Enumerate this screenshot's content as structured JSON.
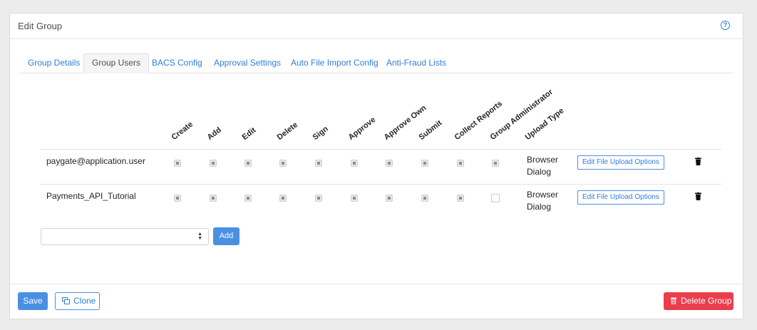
{
  "header": {
    "title": "Edit Group",
    "help_icon": "question-circle-icon"
  },
  "tabs": [
    {
      "label": "Group Details",
      "active": false
    },
    {
      "label": "Group Users",
      "active": true
    },
    {
      "label": "BACS Config",
      "active": false
    },
    {
      "label": "Approval Settings",
      "active": false
    },
    {
      "label": "Auto File Import Config",
      "active": false
    },
    {
      "label": "Anti-Fraud Lists",
      "active": false
    }
  ],
  "columns": [
    "Create",
    "Add",
    "Edit",
    "Delete",
    "Sign",
    "Approve",
    "Approve Own",
    "Submit",
    "Collect Reports",
    "Group Administrator",
    "Upload Type"
  ],
  "users": [
    {
      "name": "paygate@application.user",
      "permissions": [
        true,
        true,
        true,
        true,
        true,
        true,
        true,
        true,
        true,
        true
      ],
      "upload_type_line1": "Browser",
      "upload_type_line2": "Dialog",
      "edit_upload_label": "Edit File Upload Options"
    },
    {
      "name": "Payments_API_Tutorial",
      "permissions": [
        true,
        true,
        true,
        true,
        true,
        true,
        true,
        true,
        true,
        false
      ],
      "upload_type_line1": "Browser",
      "upload_type_line2": "Dialog",
      "edit_upload_label": "Edit File Upload Options"
    }
  ],
  "add_user": {
    "select_value": "",
    "add_label": "Add"
  },
  "footer": {
    "save_label": "Save",
    "clone_label": "Clone",
    "delete_label": "Delete Group"
  },
  "colors": {
    "primary": "#4a90e2",
    "link": "#2f7ed8",
    "danger": "#ea3e4d"
  }
}
